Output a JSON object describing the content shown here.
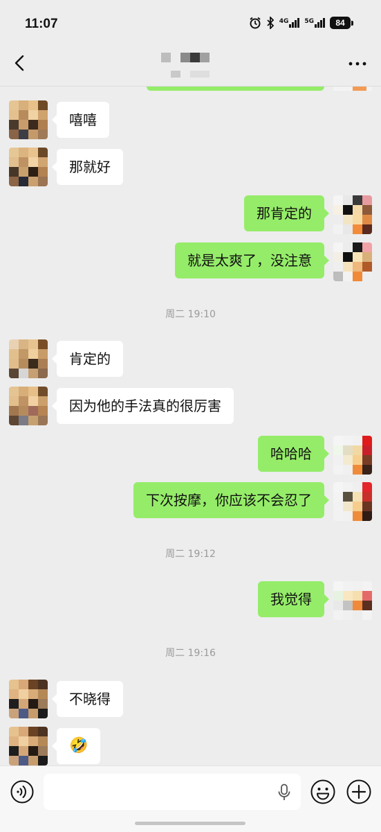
{
  "status_bar": {
    "time": "11:07",
    "battery": "84",
    "net1": "4G",
    "net2": "5G"
  },
  "nav": {
    "back_icon": "chevron-left-icon",
    "more_icon": "ellipsis-icon"
  },
  "messages": [
    {
      "side": "in",
      "text": "嘻嘻"
    },
    {
      "side": "in",
      "text": "那就好"
    },
    {
      "side": "out",
      "text": "那肯定的"
    },
    {
      "side": "out",
      "text": "就是太爽了，没注意"
    },
    {
      "side": "in",
      "text": "肯定的"
    },
    {
      "side": "in",
      "text": "因为他的手法真的很厉害"
    },
    {
      "side": "out",
      "text": "哈哈哈"
    },
    {
      "side": "out",
      "text": "下次按摩，你应该不会忍了"
    },
    {
      "side": "out",
      "text": "我觉得"
    },
    {
      "side": "in",
      "text": "不晓得"
    },
    {
      "side": "in",
      "text": "🤣"
    }
  ],
  "timestamps": [
    "周二 19:10",
    "周二 19:12",
    "周二 19:16"
  ],
  "input": {
    "value": "",
    "placeholder": ""
  },
  "colors": {
    "bg": "#ededed",
    "out_bubble": "#95ec69",
    "in_bubble": "#ffffff",
    "timestamp": "#9a9a9a"
  }
}
